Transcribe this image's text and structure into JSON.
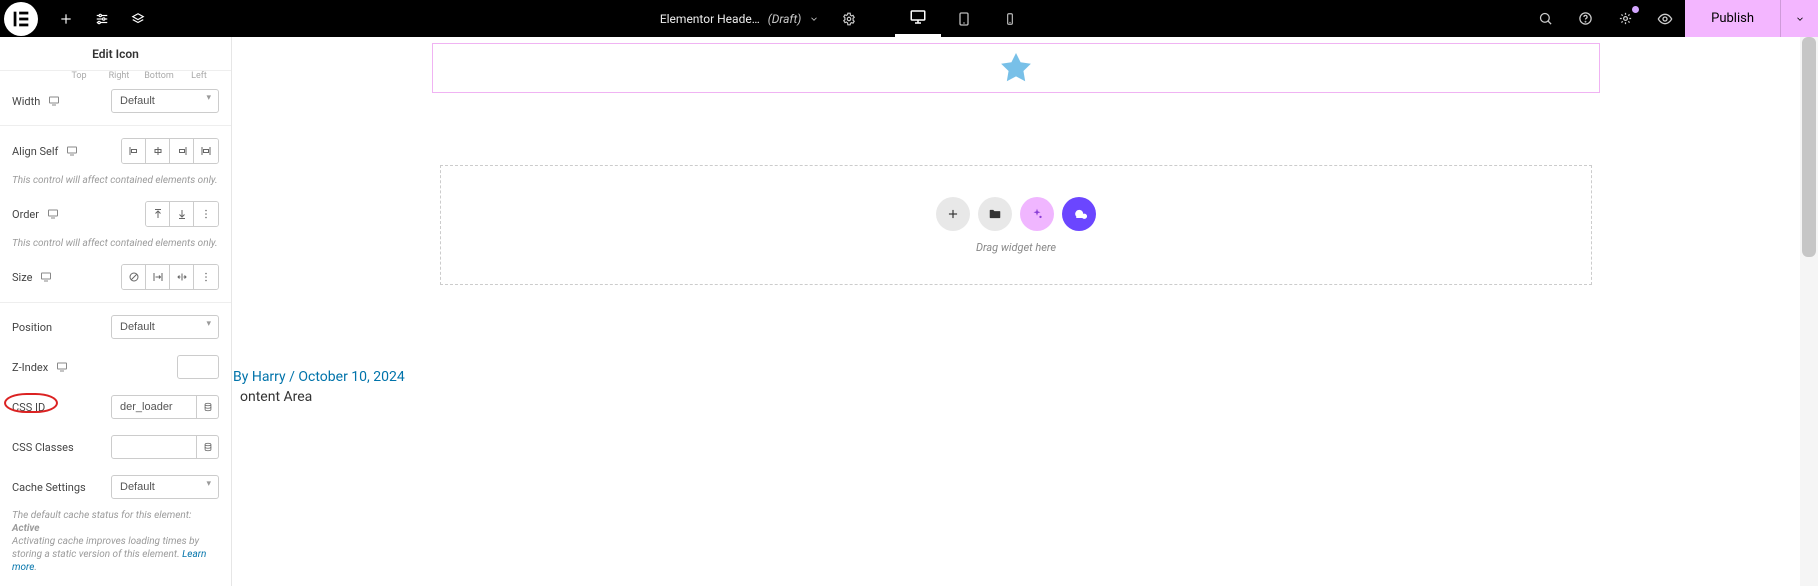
{
  "topbar": {
    "title": "Elementor Heade…",
    "status": "(Draft)",
    "publish": "Publish"
  },
  "sidebar": {
    "panel_title": "Edit Icon",
    "edges": {
      "top": "Top",
      "right": "Right",
      "bottom": "Bottom",
      "left": "Left"
    },
    "width_label": "Width",
    "width_value": "Default",
    "align_self_label": "Align Self",
    "help1": "This control will affect contained elements only.",
    "order_label": "Order",
    "help2": "This control will affect contained elements only.",
    "size_label": "Size",
    "position_label": "Position",
    "position_value": "Default",
    "zindex_label": "Z-Index",
    "zindex_value": "",
    "cssid_label": "CSS ID",
    "cssid_value": "der_loader",
    "cssclasses_label": "CSS Classes",
    "cssclasses_value": "",
    "cache_label": "Cache Settings",
    "cache_value": "Default",
    "cache_help_1": "The default cache status for this element: ",
    "cache_help_bold": "Active",
    "cache_help_2": "Activating cache improves loading times by storing a static version of this element. ",
    "learn_more": "Learn more"
  },
  "canvas": {
    "drag_text": "Drag widget here",
    "byline_prefix": "By ",
    "byline_author": "Harry",
    "byline_sep": " / ",
    "byline_date": "October 10, 2024",
    "content_area": "ontent Area"
  }
}
